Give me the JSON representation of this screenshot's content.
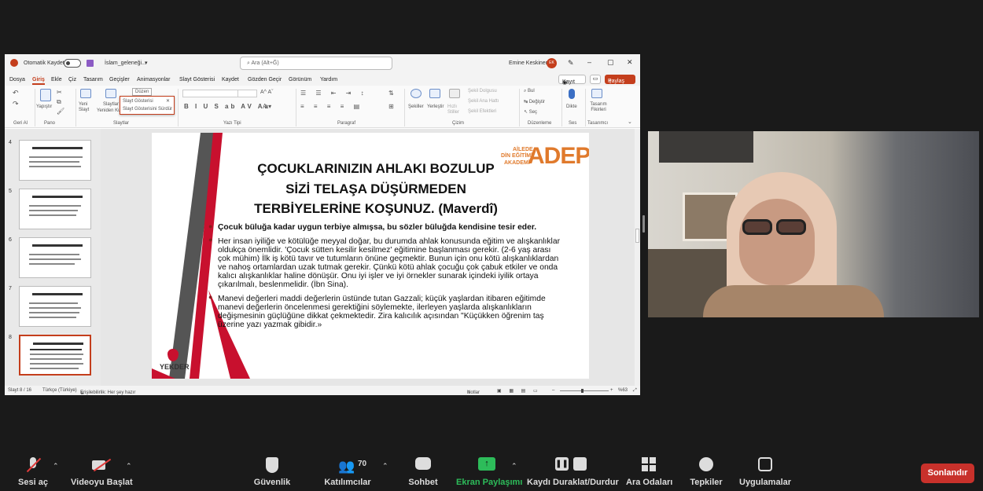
{
  "ppt": {
    "autosave_label": "Otomatik Kaydet",
    "file_name": "İslam_geleneği...",
    "search_placeholder": "Ara (Alt+Ğ)",
    "user_name": "Emine Keskiner",
    "user_initials": "EK",
    "window_buttons": [
      "–",
      "▢",
      "✕"
    ],
    "menu": [
      "Dosya",
      "Giriş",
      "Ekle",
      "Çiz",
      "Tasarım",
      "Geçişler",
      "Animasyonlar",
      "Slayt Gösterisi",
      "Kaydet",
      "Gözden Geçir",
      "Görünüm",
      "Yardım"
    ],
    "menu_active": "Giriş",
    "record_btn": "Kayıt",
    "share_btn": "Paylaş",
    "ribbon": {
      "undo_group": "Geri Al",
      "paste": "Yapıştır",
      "clipboard_group": "Pano",
      "new_slide": "Yeni Slayt",
      "slides_label": "Slaytlar",
      "reuse_label": "Yeniden Ku",
      "layout_label": "Düzen",
      "slide_show_label": "Slayt Gösterisi",
      "slide_show_continue": "Slayt Gösterisini Sürdür",
      "slides_group": "Slaytlar",
      "font_group": "Yazı Tipi",
      "paragraph_group": "Paragraf",
      "shapes": "Şekiller",
      "arrange": "Yerleştir",
      "quick_styles": "Hızlı Stiller",
      "shape_fill": "Şekil Dolgusu",
      "shape_outline": "Şekil Ana Hattı",
      "shape_effects": "Şekil Efektleri",
      "drawing_group": "Çizim",
      "find": "Bul",
      "replace": "Değiştir",
      "select": "Seç",
      "editing_group": "Düzenleme",
      "dictate": "Dikte",
      "voice_group": "Ses",
      "designer": "Tasarım Fikirleri",
      "designer_group": "Tasarımcı"
    },
    "thumbnail_numbers": [
      "4",
      "5",
      "6",
      "7",
      "8"
    ],
    "status": {
      "slide_pos": "Slayt 8 / 16",
      "language": "Türkçe (Türkiye)",
      "accessibility": "Erişilebilirlik: Her şey hazır",
      "notes": "Notlar",
      "zoom": "%63"
    }
  },
  "slide": {
    "logo_small_1": "AİLEDE",
    "logo_small_2": "DİN EĞİTİMİ",
    "logo_small_3": "AKADEMİ",
    "logo_big": "ADEP",
    "footer_logo": "YEKDER",
    "title_1": "ÇOCUKLARINIZIN AHLAKI BOZULUP",
    "title_2": "SİZİ TELAŞA DÜŞÜRMEDEN",
    "title_3": "TERBİYELERİNE KOŞUNUZ. (Maverdî)",
    "bullet_1": "Çocuk büluğa kadar uygun terbiye almışsa, bu sözler büluğda kendisine tesir eder.",
    "bullet_2": "Her insan iyiliğe ve kötülüğe meyyal doğar, bu durumda ahlak konusunda eğitim ve alışkanlıklar oldukça önemlidir. 'Çocuk sütten kesilir kesilmez' eğitimine başlanması gerekir. (2-6 yaş arası çok mühim) İlk iş kötü tavır ve tutumların önüne geçmektir. Bunun için onu kötü alışkanlıklardan ve nahoş ortamlardan uzak tutmak gerekir. Çünkü kötü ahlak çocuğu çok çabuk etkiler ve onda kalıcı alışkanlıklar haline dönüşür. Onu iyi işler ve iyi örnekler sunarak içindeki iyilik ortaya çıkarılmalı, beslenmelidir. (İbn Sina).",
    "bullet_3": "Manevi değerleri maddi değerlerin üstünde tutan Gazzali; küçük yaşlardan itibaren eğitimde manevi değerlerin öncelenmesi gerektiğini söylemekte, ilerleyen yaşlarda alışkanlıkların değişmesinin güçlüğüne dikkat çekmektedir. Zira kalıcılık açısından \"Küçükken öğrenim taş üzerine yazı yazmak gibidir.»"
  },
  "zoom": {
    "audio": "Sesi aç",
    "video": "Videoyu Başlat",
    "security": "Güvenlik",
    "participants": "Katılımcılar",
    "participants_count": "70",
    "chat": "Sohbet",
    "share": "Ekran Paylaşımı",
    "record": "Kaydı Duraklat/Durdur",
    "breakout": "Ara Odaları",
    "reactions": "Tepkiler",
    "apps": "Uygulamalar",
    "end": "Sonlandır"
  },
  "colors": {
    "accent": "#c43e1c",
    "zoom_green": "#2dbc5a",
    "end_red": "#c8312b",
    "slide_red": "#c8102e"
  }
}
